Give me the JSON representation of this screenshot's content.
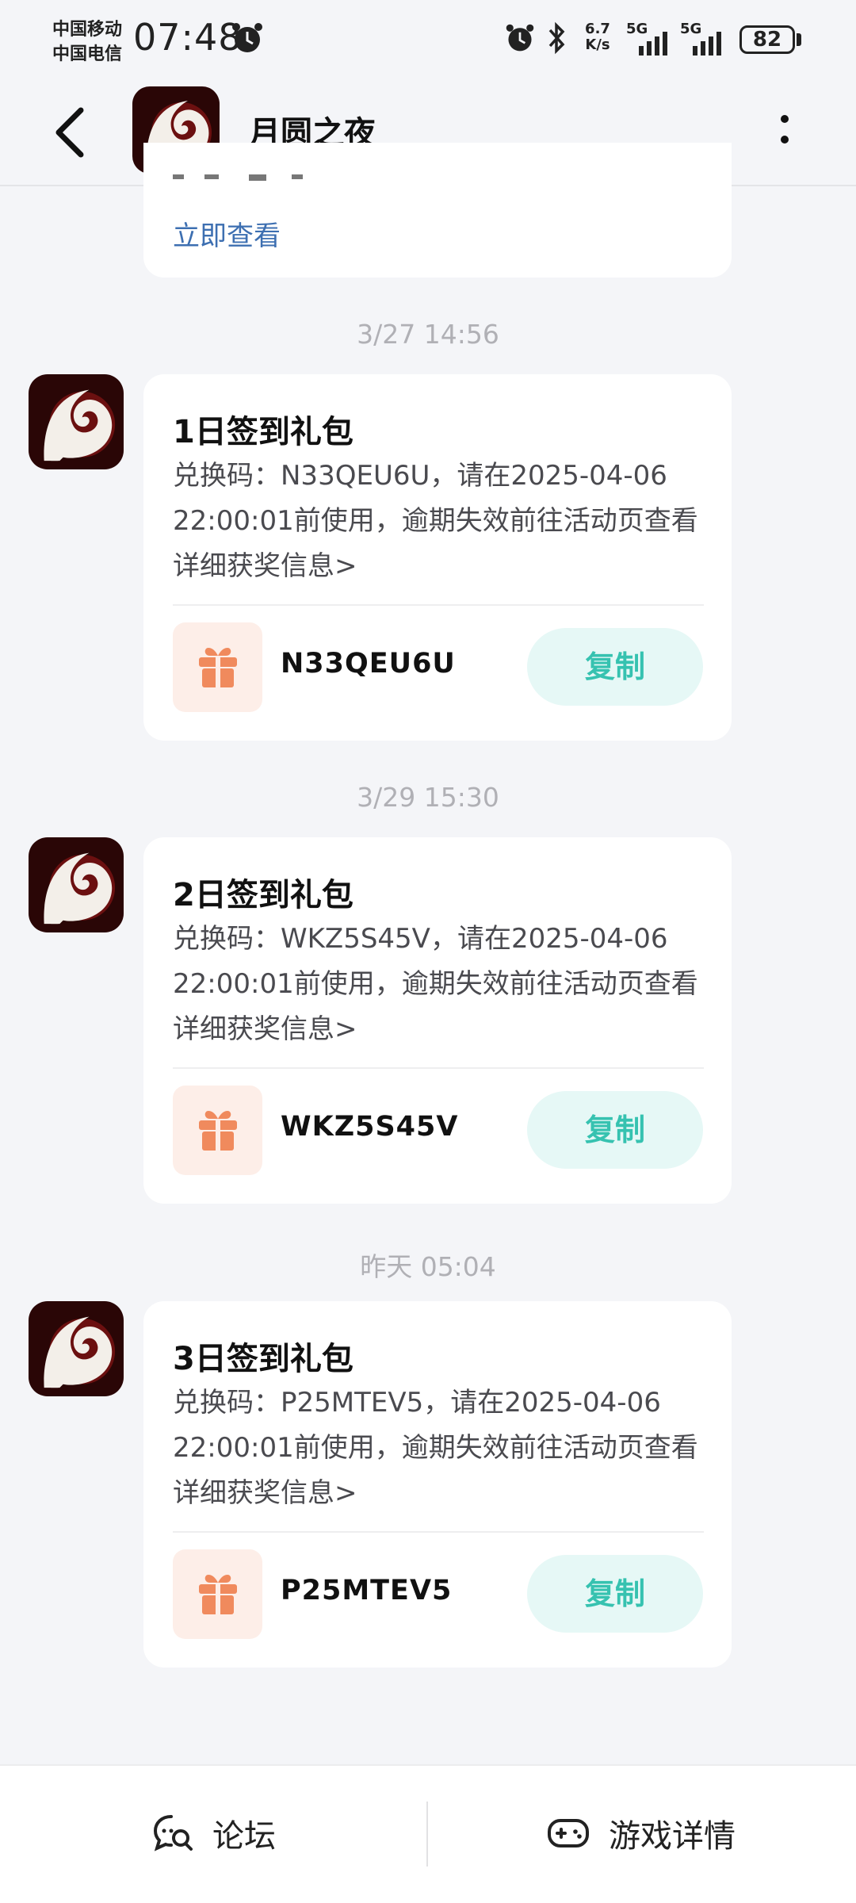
{
  "status_bar": {
    "carrier_1": "中国移动",
    "carrier_2": "中国电信",
    "time": "07:48",
    "net_speed_value": "6.7",
    "net_speed_unit": "K/s",
    "signal_1": "5G",
    "signal_2": "5G",
    "battery": "82"
  },
  "header": {
    "title": "月圆之夜"
  },
  "previous_message": {
    "link_text": "立即查看"
  },
  "messages": [
    {
      "timestamp": "3/27  14:56",
      "title": "1日签到礼包",
      "body": "兑换码：N33QEU6U，请在2025-04-06 22:00:01前使用，逾期失效前往活动页查看详细获奖信息>",
      "code": "N33QEU6U",
      "copy_label": "复制"
    },
    {
      "timestamp": "3/29  15:30",
      "title": "2日签到礼包",
      "body": "兑换码：WKZ5S45V，请在2025-04-06 22:00:01前使用，逾期失效前往活动页查看详细获奖信息>",
      "code": "WKZ5S45V",
      "copy_label": "复制"
    },
    {
      "timestamp": "昨天  05:04",
      "title": "3日签到礼包",
      "body": "兑换码：P25MTEV5，请在2025-04-06 22:00:01前使用，逾期失效前往活动页查看详细获奖信息>",
      "code": "P25MTEV5",
      "copy_label": "复制"
    }
  ],
  "bottom_bar": {
    "forum_label": "论坛",
    "game_details_label": "游戏详情"
  },
  "colors": {
    "accent_teal": "#36c2b0",
    "link_blue": "#3d6fb1",
    "gift_orange": "#f08a5d"
  },
  "icons": {
    "app_icon": "moon-night-game-icon",
    "gift": "gift-icon",
    "forum": "chat-search-icon",
    "game": "gamepad-icon"
  }
}
